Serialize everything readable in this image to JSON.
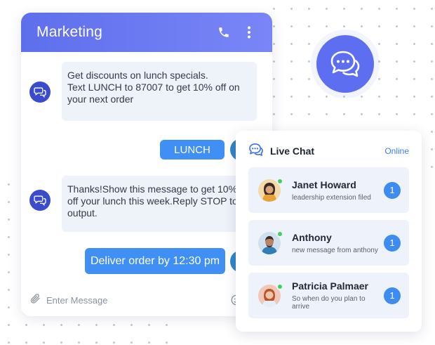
{
  "chat": {
    "title": "Marketing",
    "messages": [
      {
        "direction": "incoming",
        "text": "Get discounts on lunch specials.\nText LUNCH to 87007 to get 10% off on your next order"
      },
      {
        "direction": "outgoing",
        "text": "LUNCH"
      },
      {
        "direction": "incoming",
        "text": "Thanks!Show this message to get 10% off your lunch this week.Reply STOP to output."
      },
      {
        "direction": "outgoing",
        "text": "Deliver order by 12:30 pm"
      }
    ],
    "composer": {
      "placeholder": "Enter Message"
    }
  },
  "live_chat": {
    "title": "Live Chat",
    "status": "Online",
    "contacts": [
      {
        "name": "Janet Howard",
        "preview": "leadership extension filed",
        "unread": "1"
      },
      {
        "name": "Anthony",
        "preview": "new message from anthony",
        "unread": "1"
      },
      {
        "name": "Patricia Palmaer",
        "preview": "So when do you plan to arrive",
        "unread": "1"
      }
    ]
  },
  "icons": {
    "header": [
      "phone-icon",
      "more-vertical-icon"
    ],
    "composer": [
      "paperclip-icon",
      "emoji-icon"
    ],
    "feature": "chat-bubbles-icon",
    "colors": {
      "accent": "#5e6ef0",
      "bubble_out": "#3f8ff5",
      "online": "#3fd15f"
    }
  }
}
